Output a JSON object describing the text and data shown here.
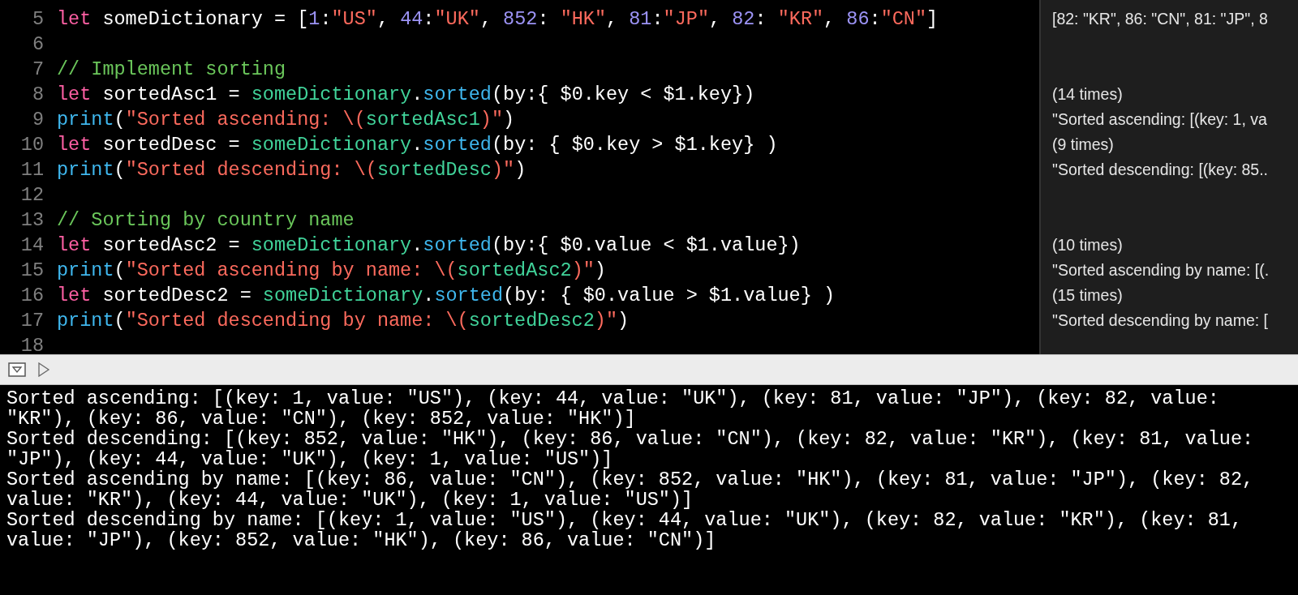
{
  "editor": {
    "lines": [
      {
        "number": "5",
        "tokens": [
          {
            "kind": "keyword",
            "text": "let"
          },
          {
            "kind": "plain",
            "text": " someDictionary = ["
          },
          {
            "kind": "number",
            "text": "1"
          },
          {
            "kind": "plain",
            "text": ":"
          },
          {
            "kind": "string",
            "text": "\"US\""
          },
          {
            "kind": "plain",
            "text": ", "
          },
          {
            "kind": "number",
            "text": "44"
          },
          {
            "kind": "plain",
            "text": ":"
          },
          {
            "kind": "string",
            "text": "\"UK\""
          },
          {
            "kind": "plain",
            "text": ", "
          },
          {
            "kind": "number",
            "text": "852"
          },
          {
            "kind": "plain",
            "text": ": "
          },
          {
            "kind": "string",
            "text": "\"HK\""
          },
          {
            "kind": "plain",
            "text": ", "
          },
          {
            "kind": "number",
            "text": "81"
          },
          {
            "kind": "plain",
            "text": ":"
          },
          {
            "kind": "string",
            "text": "\"JP\""
          },
          {
            "kind": "plain",
            "text": ", "
          },
          {
            "kind": "number",
            "text": "82"
          },
          {
            "kind": "plain",
            "text": ": "
          },
          {
            "kind": "string",
            "text": "\"KR\""
          },
          {
            "kind": "plain",
            "text": ", "
          },
          {
            "kind": "number",
            "text": "86"
          },
          {
            "kind": "plain",
            "text": ":"
          },
          {
            "kind": "string",
            "text": "\"CN\""
          },
          {
            "kind": "plain",
            "text": "]"
          }
        ],
        "result": "[82: \"KR\", 86: \"CN\", 81: \"JP\", 8"
      },
      {
        "number": "6"
      },
      {
        "number": "7",
        "tokens": [
          {
            "kind": "comment",
            "text": "// Implement sorting"
          }
        ]
      },
      {
        "number": "8",
        "tokens": [
          {
            "kind": "keyword",
            "text": "let"
          },
          {
            "kind": "plain",
            "text": " sortedAsc1 = "
          },
          {
            "kind": "identifier",
            "text": "someDictionary"
          },
          {
            "kind": "plain",
            "text": "."
          },
          {
            "kind": "function",
            "text": "sorted"
          },
          {
            "kind": "plain",
            "text": "(by:{ $0.key < $1.key})"
          }
        ],
        "result": "(14 times)"
      },
      {
        "number": "9",
        "tokens": [
          {
            "kind": "function",
            "text": "print"
          },
          {
            "kind": "plain",
            "text": "("
          },
          {
            "kind": "string",
            "text": "\"Sorted ascending: \\("
          },
          {
            "kind": "identifier",
            "text": "sortedAsc1"
          },
          {
            "kind": "string",
            "text": ")\""
          },
          {
            "kind": "plain",
            "text": ")"
          }
        ],
        "result": "\"Sorted ascending: [(key: 1, va"
      },
      {
        "number": "10",
        "tokens": [
          {
            "kind": "keyword",
            "text": "let"
          },
          {
            "kind": "plain",
            "text": " sortedDesc = "
          },
          {
            "kind": "identifier",
            "text": "someDictionary"
          },
          {
            "kind": "plain",
            "text": "."
          },
          {
            "kind": "function",
            "text": "sorted"
          },
          {
            "kind": "plain",
            "text": "(by: { $0.key > $1.key} )"
          }
        ],
        "result": "(9 times)"
      },
      {
        "number": "11",
        "tokens": [
          {
            "kind": "function",
            "text": "print"
          },
          {
            "kind": "plain",
            "text": "("
          },
          {
            "kind": "string",
            "text": "\"Sorted descending: \\("
          },
          {
            "kind": "identifier",
            "text": "sortedDesc"
          },
          {
            "kind": "string",
            "text": ")\""
          },
          {
            "kind": "plain",
            "text": ")"
          }
        ],
        "result": "\"Sorted descending: [(key: 85.."
      },
      {
        "number": "12"
      },
      {
        "number": "13",
        "tokens": [
          {
            "kind": "comment",
            "text": "// Sorting by country name"
          }
        ]
      },
      {
        "number": "14",
        "tokens": [
          {
            "kind": "keyword",
            "text": "let"
          },
          {
            "kind": "plain",
            "text": " sortedAsc2 = "
          },
          {
            "kind": "identifier",
            "text": "someDictionary"
          },
          {
            "kind": "plain",
            "text": "."
          },
          {
            "kind": "function",
            "text": "sorted"
          },
          {
            "kind": "plain",
            "text": "(by:{ $0.value < $1.value})"
          }
        ],
        "result": "(10 times)"
      },
      {
        "number": "15",
        "tokens": [
          {
            "kind": "function",
            "text": "print"
          },
          {
            "kind": "plain",
            "text": "("
          },
          {
            "kind": "string",
            "text": "\"Sorted ascending by name: \\("
          },
          {
            "kind": "identifier",
            "text": "sortedAsc2"
          },
          {
            "kind": "string",
            "text": ")\""
          },
          {
            "kind": "plain",
            "text": ")"
          }
        ],
        "result": "\"Sorted ascending by name: [(."
      },
      {
        "number": "16",
        "tokens": [
          {
            "kind": "keyword",
            "text": "let"
          },
          {
            "kind": "plain",
            "text": " sortedDesc2 = "
          },
          {
            "kind": "identifier",
            "text": "someDictionary"
          },
          {
            "kind": "plain",
            "text": "."
          },
          {
            "kind": "function",
            "text": "sorted"
          },
          {
            "kind": "plain",
            "text": "(by: { $0.value > $1.value} )"
          }
        ],
        "result": "(15 times)"
      },
      {
        "number": "17",
        "tokens": [
          {
            "kind": "function",
            "text": "print"
          },
          {
            "kind": "plain",
            "text": "("
          },
          {
            "kind": "string",
            "text": "\"Sorted descending by name: \\("
          },
          {
            "kind": "identifier",
            "text": "sortedDesc2"
          },
          {
            "kind": "string",
            "text": ")\""
          },
          {
            "kind": "plain",
            "text": ")"
          }
        ],
        "result": "\"Sorted descending by name: ["
      },
      {
        "number": "18"
      }
    ]
  },
  "console": {
    "output": [
      "Sorted ascending: [(key: 1, value: \"US\"), (key: 44, value: \"UK\"), (key: 81, value: \"JP\"), (key: 82, value: \"KR\"), (key: 86, value: \"CN\"), (key: 852, value: \"HK\")]",
      "Sorted descending: [(key: 852, value: \"HK\"), (key: 86, value: \"CN\"), (key: 82, value: \"KR\"), (key: 81, value: \"JP\"), (key: 44, value: \"UK\"), (key: 1, value: \"US\")]",
      "Sorted ascending by name: [(key: 86, value: \"CN\"), (key: 852, value: \"HK\"), (key: 81, value: \"JP\"), (key: 82, value: \"KR\"), (key: 44, value: \"UK\"), (key: 1, value: \"US\")]",
      "Sorted descending by name: [(key: 1, value: \"US\"), (key: 44, value: \"UK\"), (key: 82, value: \"KR\"), (key: 81, value: \"JP\"), (key: 852, value: \"HK\"), (key: 86, value: \"CN\")]"
    ]
  }
}
